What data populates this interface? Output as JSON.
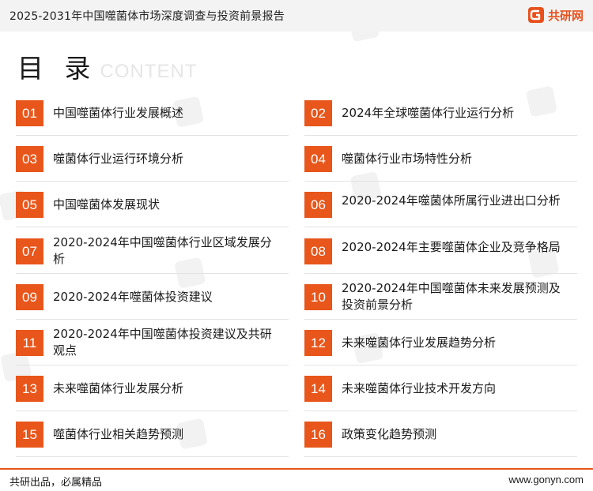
{
  "header": {
    "title": "2025-2031年中国噬菌体市场深度调查与投资前景报告",
    "brand": "共研网",
    "brand_color": "#e8501c"
  },
  "heading": {
    "main": "目 录",
    "sub": "CONTENT"
  },
  "toc": [
    {
      "num": "01",
      "label": "中国噬菌体行业发展概述"
    },
    {
      "num": "02",
      "label": "2024年全球噬菌体行业运行分析"
    },
    {
      "num": "03",
      "label": "噬菌体行业运行环境分析"
    },
    {
      "num": "04",
      "label": "噬菌体行业市场特性分析"
    },
    {
      "num": "05",
      "label": "中国噬菌体发展现状"
    },
    {
      "num": "06",
      "label": "2020-2024年噬菌体所属行业进出口分析"
    },
    {
      "num": "07",
      "label": "2020-2024年中国噬菌体行业区域发展分析"
    },
    {
      "num": "08",
      "label": "2020-2024年主要噬菌体企业及竞争格局"
    },
    {
      "num": "09",
      "label": "2020-2024年噬菌体投资建议"
    },
    {
      "num": "10",
      "label": "2020-2024年中国噬菌体未来发展预测及投资前景分析"
    },
    {
      "num": "11",
      "label": "2020-2024年中国噬菌体投资建议及共研观点"
    },
    {
      "num": "12",
      "label": "未来噬菌体行业发展趋势分析"
    },
    {
      "num": "13",
      "label": "未来噬菌体行业发展分析"
    },
    {
      "num": "14",
      "label": "未来噬菌体行业技术开发方向"
    },
    {
      "num": "15",
      "label": "噬菌体行业相关趋势预测"
    },
    {
      "num": "16",
      "label": "政策变化趋势预测"
    }
  ],
  "footer": {
    "left": "共研出品，必属精品",
    "right": "www.gonyn.com"
  },
  "accent_color": "#e8561b"
}
